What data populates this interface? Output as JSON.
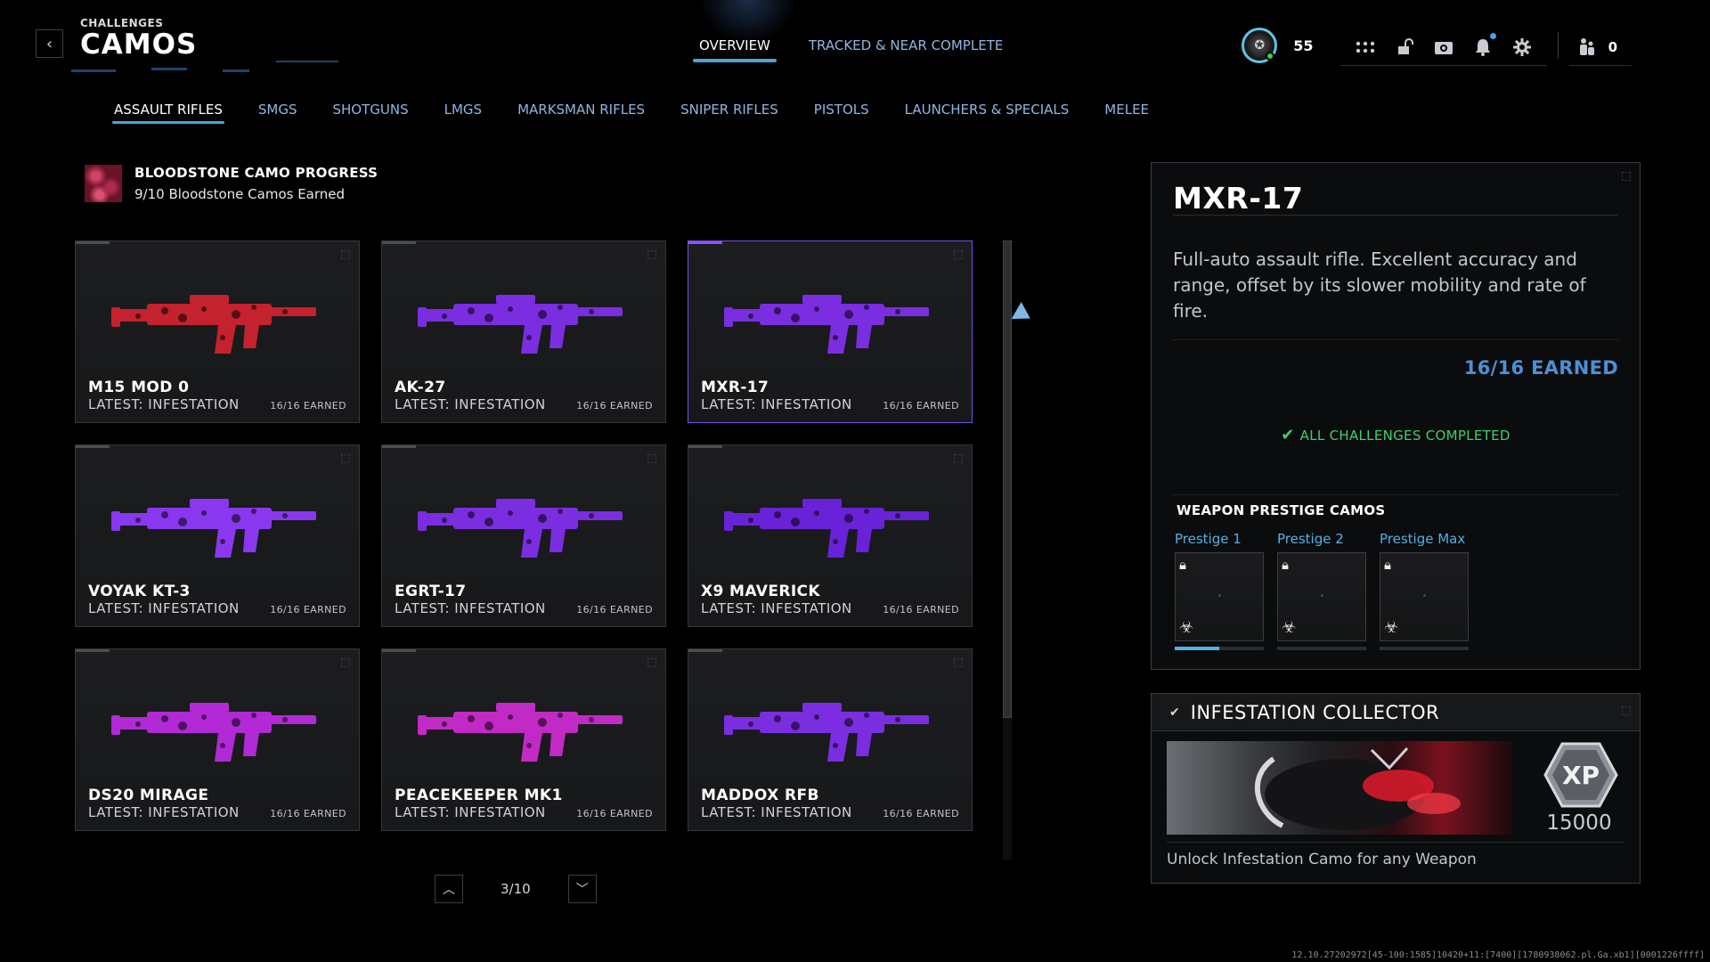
{
  "header": {
    "section": "CHALLENGES",
    "title": "CAMOS",
    "tabs": [
      {
        "label": "OVERVIEW",
        "active": true
      },
      {
        "label": "TRACKED & NEAR COMPLETE",
        "active": false
      }
    ],
    "player_level": "55",
    "friends_online": "0",
    "icons": [
      "back-icon",
      "grid-icon",
      "unlock-icon",
      "camera-icon",
      "bell-icon",
      "gear-icon",
      "party-icon"
    ]
  },
  "categories": [
    {
      "label": "ASSAULT RIFLES",
      "active": true
    },
    {
      "label": "SMGS",
      "active": false
    },
    {
      "label": "SHOTGUNS",
      "active": false
    },
    {
      "label": "LMGS",
      "active": false
    },
    {
      "label": "MARKSMAN RIFLES",
      "active": false
    },
    {
      "label": "SNIPER RIFLES",
      "active": false
    },
    {
      "label": "PISTOLS",
      "active": false
    },
    {
      "label": "LAUNCHERS & SPECIALS",
      "active": false
    },
    {
      "label": "MELEE",
      "active": false
    }
  ],
  "progress": {
    "title": "BLOODSTONE CAMO PROGRESS",
    "subtitle": "9/10 Bloodstone Camos Earned"
  },
  "weapons": [
    {
      "name": "M15 MOD 0",
      "latest": "LATEST: INFESTATION",
      "earned": "16/16 EARNED",
      "camo": "#c4222e",
      "selected": false
    },
    {
      "name": "AK-27",
      "latest": "LATEST: INFESTATION",
      "earned": "16/16 EARNED",
      "camo": "#7a2ee0",
      "selected": false
    },
    {
      "name": "MXR-17",
      "latest": "LATEST: INFESTATION",
      "earned": "16/16 EARNED",
      "camo": "#7a2ee0",
      "selected": true
    },
    {
      "name": "VOYAK KT-3",
      "latest": "LATEST: INFESTATION",
      "earned": "16/16 EARNED",
      "camo": "#8a38f0",
      "selected": false
    },
    {
      "name": "EGRT-17",
      "latest": "LATEST: INFESTATION",
      "earned": "16/16 EARNED",
      "camo": "#7a2ee0",
      "selected": false
    },
    {
      "name": "X9 MAVERICK",
      "latest": "LATEST: INFESTATION",
      "earned": "16/16 EARNED",
      "camo": "#6a22d8",
      "selected": false
    },
    {
      "name": "DS20 MIRAGE",
      "latest": "LATEST: INFESTATION",
      "earned": "16/16 EARNED",
      "camo": "#b12ad6",
      "selected": false
    },
    {
      "name": "PEACEKEEPER MK1",
      "latest": "LATEST: INFESTATION",
      "earned": "16/16 EARNED",
      "camo": "#c22ac6",
      "selected": false
    },
    {
      "name": "MADDOX RFB",
      "latest": "LATEST: INFESTATION",
      "earned": "16/16 EARNED",
      "camo": "#7a2ee0",
      "selected": false
    }
  ],
  "pager": {
    "text": "3/10"
  },
  "detail": {
    "name": "MXR-17",
    "description": "Full-auto assault rifle. Excellent accuracy and range, offset by its slower mobility and rate of fire.",
    "earned": "16/16 EARNED",
    "status": "ALL CHALLENGES COMPLETED",
    "prestige_title": "WEAPON PRESTIGE CAMOS",
    "prestige": [
      {
        "label": "Prestige 1",
        "progress": 0.5
      },
      {
        "label": "Prestige 2",
        "progress": 0
      },
      {
        "label": "Prestige Max",
        "progress": 0
      }
    ]
  },
  "reward": {
    "title": "INFESTATION COLLECTOR",
    "xp": "15000",
    "xp_badge": "XP",
    "description": "Unlock Infestation Camo for any Weapon"
  },
  "build_info": "12.10.27202972[45-100:1585]10420+11:[7400][1780938062.pl.Ga.xb1][0001226ffff]",
  "colors": {
    "accent": "#4ea2d8",
    "selected_border": "#7a4de8",
    "complete": "#3fd06a",
    "earned": "#4d8fd6"
  }
}
